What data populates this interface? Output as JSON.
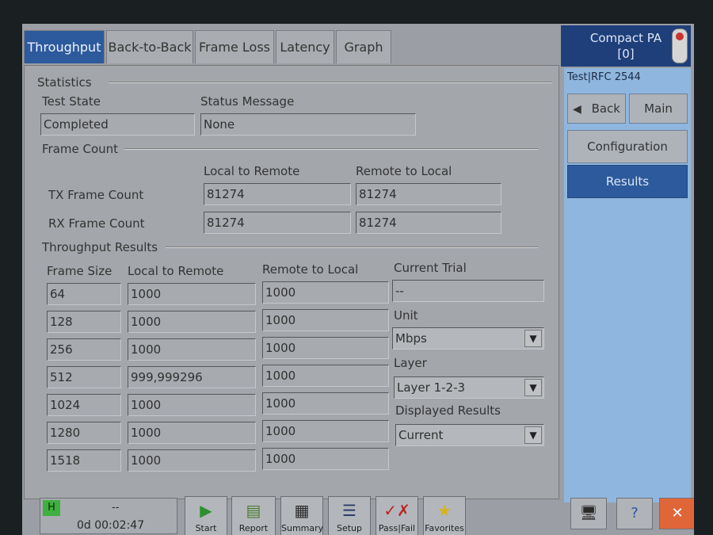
{
  "tabs": [
    "Throughput",
    "Back-to-Back",
    "Frame Loss",
    "Latency",
    "Graph"
  ],
  "statistics": {
    "group_label": "Statistics",
    "test_state_label": "Test State",
    "test_state_value": "Completed",
    "status_message_label": "Status Message",
    "status_message_value": "None"
  },
  "frame_count": {
    "group_label": "Frame Count",
    "col_local": "Local to Remote",
    "col_remote": "Remote to Local",
    "tx_label": "TX Frame Count",
    "tx_local": "81274",
    "tx_remote": "81274",
    "rx_label": "RX Frame Count",
    "rx_local": "81274",
    "rx_remote": "81274"
  },
  "throughput_results": {
    "group_label": "Throughput Results",
    "headers": [
      "Frame Size",
      "Local to Remote",
      "Remote to Local"
    ],
    "rows": [
      {
        "size": "64",
        "local": "1000",
        "remote": "1000"
      },
      {
        "size": "128",
        "local": "1000",
        "remote": "1000"
      },
      {
        "size": "256",
        "local": "1000",
        "remote": "1000"
      },
      {
        "size": "512",
        "local": "999,999296",
        "remote": "1000"
      },
      {
        "size": "1024",
        "local": "1000",
        "remote": "1000"
      },
      {
        "size": "1280",
        "local": "1000",
        "remote": "1000"
      },
      {
        "size": "1518",
        "local": "1000",
        "remote": "1000"
      }
    ],
    "current_trial_label": "Current Trial",
    "current_trial_value": "--",
    "unit_label": "Unit",
    "unit_value": "Mbps",
    "layer_label": "Layer",
    "layer_value": "Layer 1-2-3",
    "displayed_label": "Displayed Results",
    "displayed_value": "Current"
  },
  "right_panel": {
    "title_line1": "Compact PA",
    "title_line2": "[0]",
    "breadcrumb": "Test|RFC 2544",
    "back_label": "Back",
    "main_label": "Main",
    "configuration_label": "Configuration",
    "results_label": "Results"
  },
  "bottom": {
    "status_badge": "H",
    "status_text": "--",
    "elapsed": "0d 00:02:47",
    "buttons": [
      "Start",
      "Report",
      "Summary",
      "Setup",
      "Pass|Fail",
      "Favorites"
    ]
  },
  "colors": {
    "accent_blue": "#2d5a9c",
    "panel_blue": "#8fb6de",
    "status_green": "#3fb03f"
  }
}
